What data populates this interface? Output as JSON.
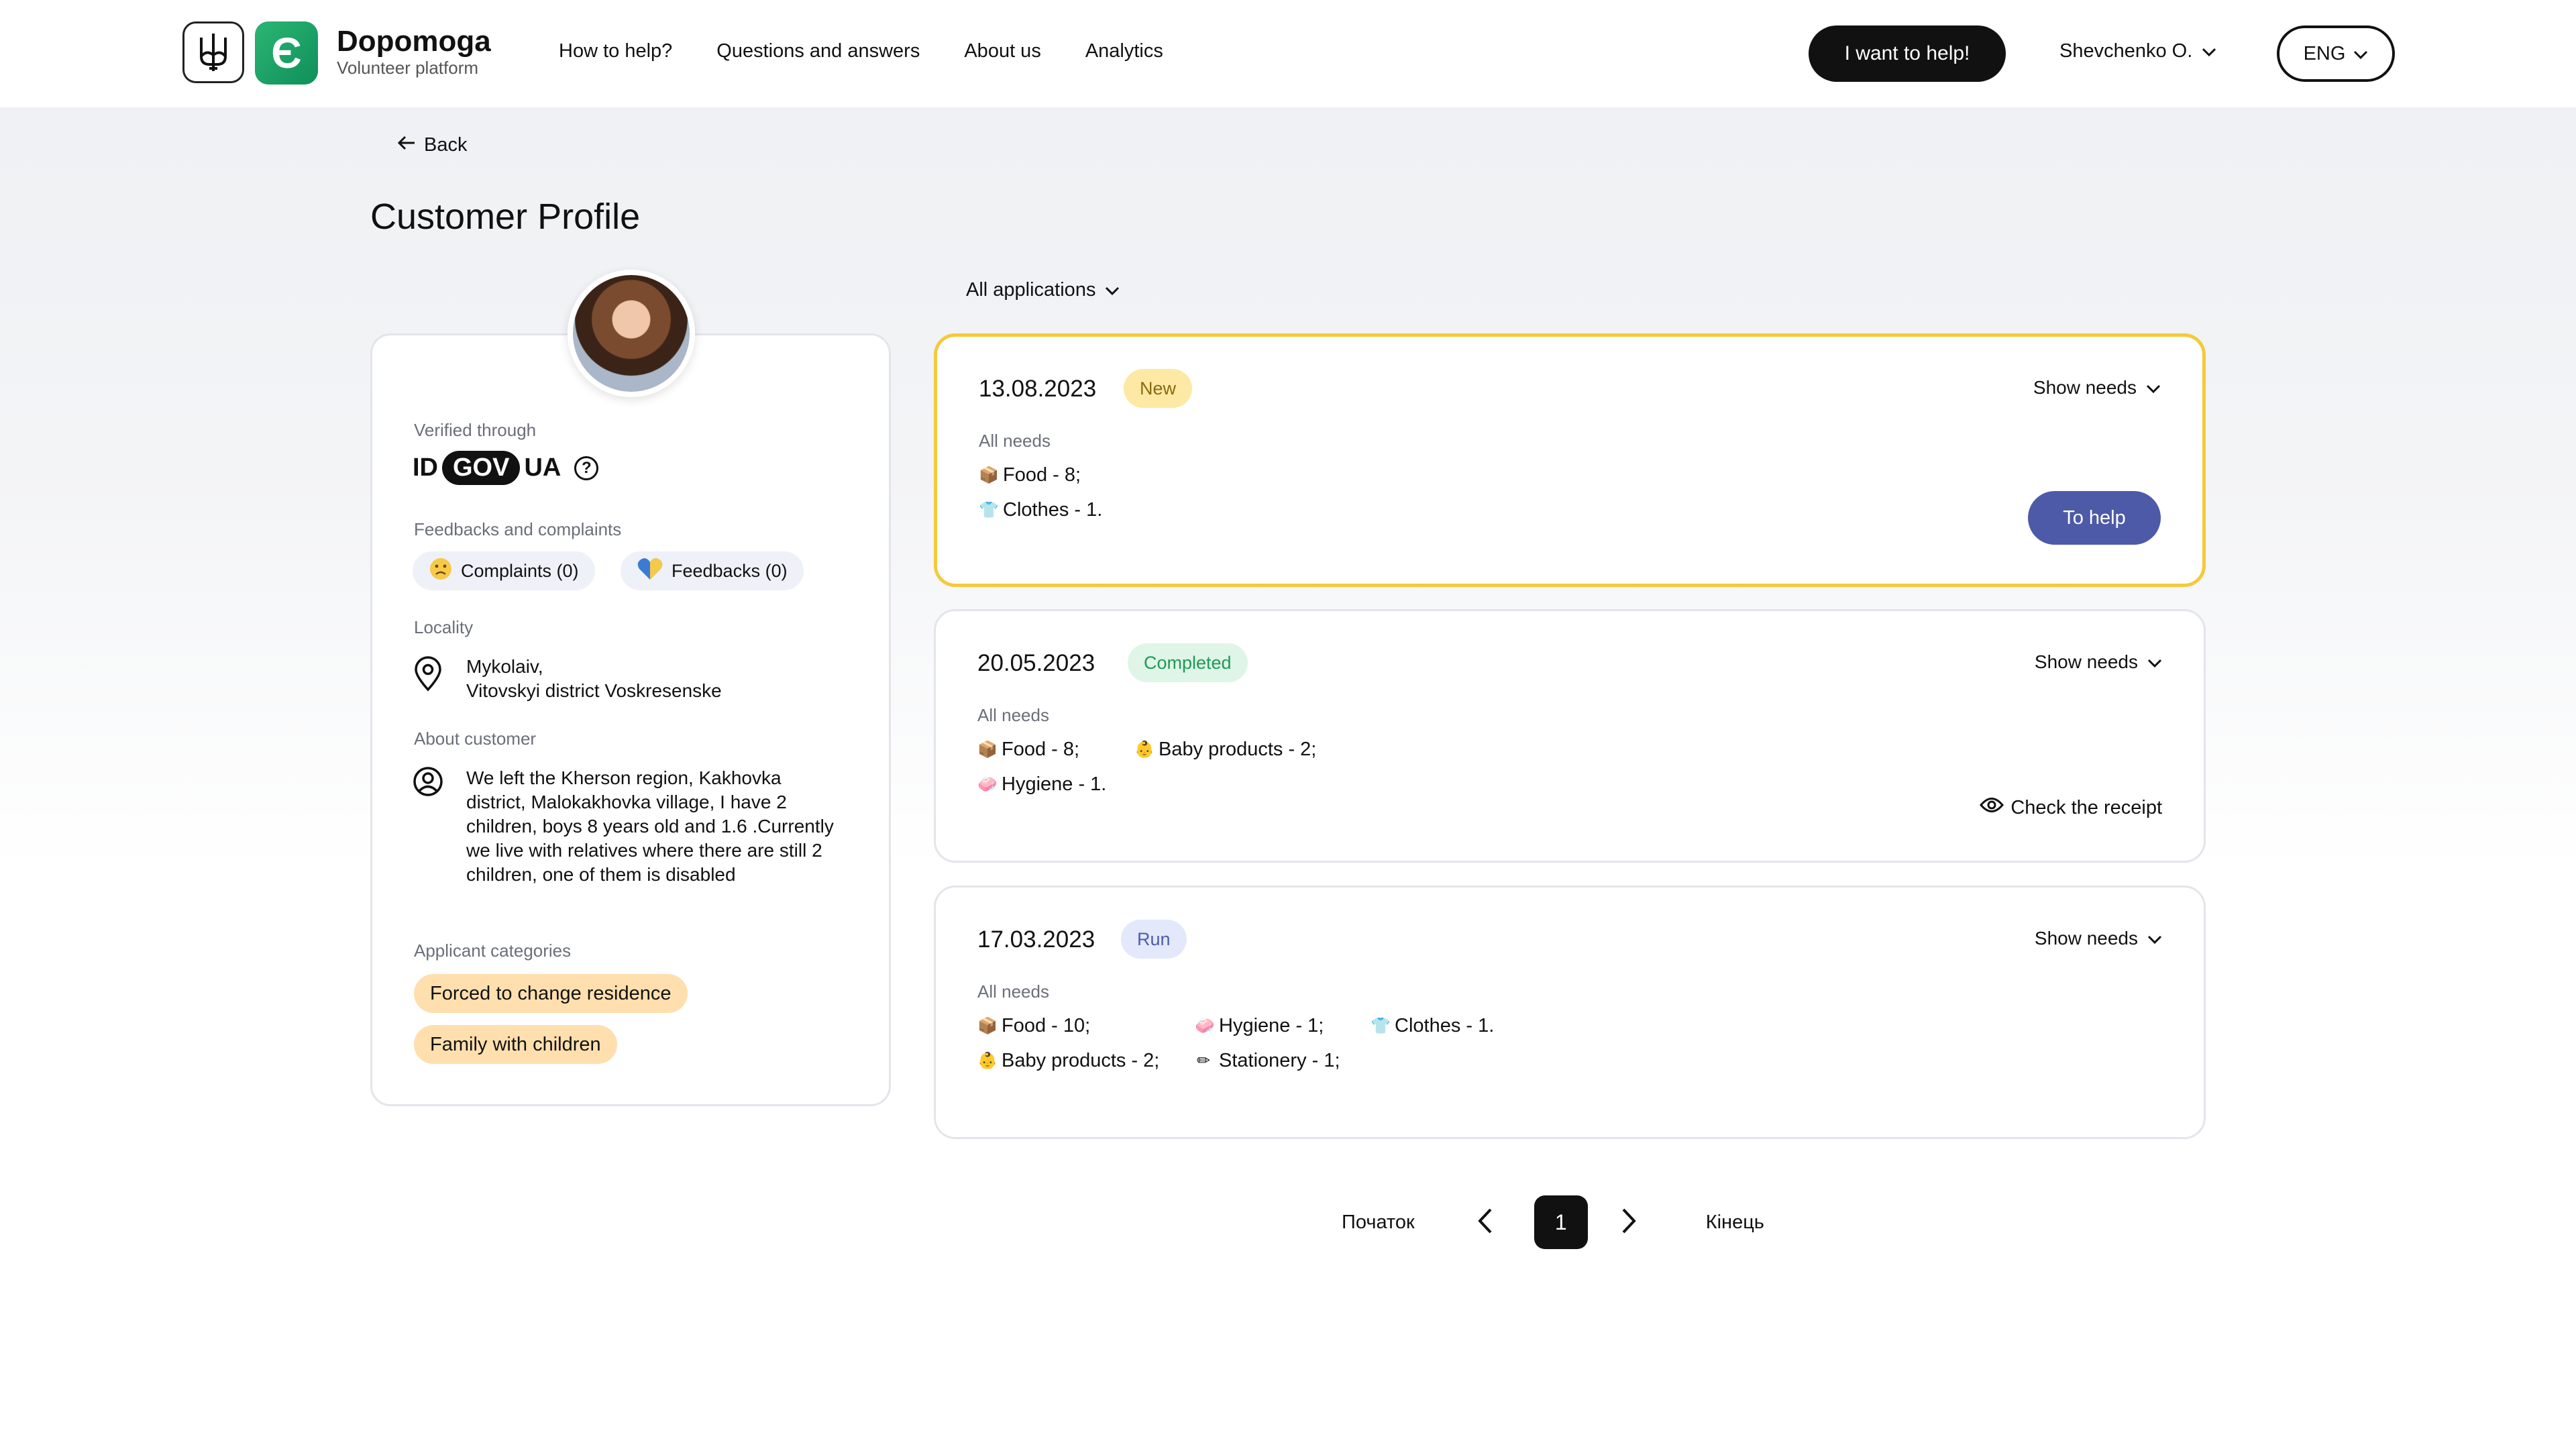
{
  "header": {
    "brand_name": "Dopomoga",
    "brand_sub": "Volunteer platform",
    "logo_letter": "Є",
    "nav": [
      "How to help?",
      "Questions and answers",
      "About us",
      "Analytics"
    ],
    "help_button": "I want to help!",
    "user_name": "Shevchenko O.",
    "language": "ENG"
  },
  "page": {
    "back_label": "Back",
    "title": "Customer Profile"
  },
  "profile": {
    "verified_label": "Verified through",
    "idgov": {
      "id": "ID",
      "gov": "GOV",
      "ua": "UA",
      "help": "?"
    },
    "feedback_label": "Feedbacks and complaints",
    "complaints": "Complaints (0)",
    "feedbacks": "Feedbacks (0)",
    "locality_label": "Locality",
    "locality_line1": "Mykolaiv,",
    "locality_line2": "Vitovskyi district Voskresenske",
    "about_label": "About customer",
    "about_text": "We left the Kherson region, Kakhovka district, Malokakhovka village, I have 2 children, boys 8 years old and 1.6 .Currently we live with relatives where there are still 2 children, one of them is disabled",
    "categories_label": "Applicant categories",
    "categories": [
      "Forced to change residence",
      "Family with children"
    ]
  },
  "filter": {
    "label": "All applications"
  },
  "applications": [
    {
      "date": "13.08.2023",
      "status": "New",
      "show_needs": "Show needs",
      "needs_label": "All needs",
      "needs": [
        "Food - 8;",
        "Clothes - 1."
      ],
      "action": "To help"
    },
    {
      "date": "20.05.2023",
      "status": "Completed",
      "show_needs": "Show needs",
      "needs_label": "All needs",
      "needs": [
        "Food - 8;",
        "Baby products - 2;",
        "Hygiene - 1."
      ],
      "action": "Check the receipt"
    },
    {
      "date": "17.03.2023",
      "status": "Run",
      "show_needs": "Show needs",
      "needs_label": "All needs",
      "needs": [
        "Food - 10;",
        "Hygiene - 1;",
        "Clothes - 1.",
        "Baby products - 2;",
        "Stationery - 1;"
      ]
    }
  ],
  "pagination": {
    "first": "Початок",
    "current": "1",
    "last": "Кінець"
  },
  "colors": {
    "accent": "#4d5aa8",
    "active_border": "#f5c93a",
    "brand_green": "#1aa566"
  }
}
